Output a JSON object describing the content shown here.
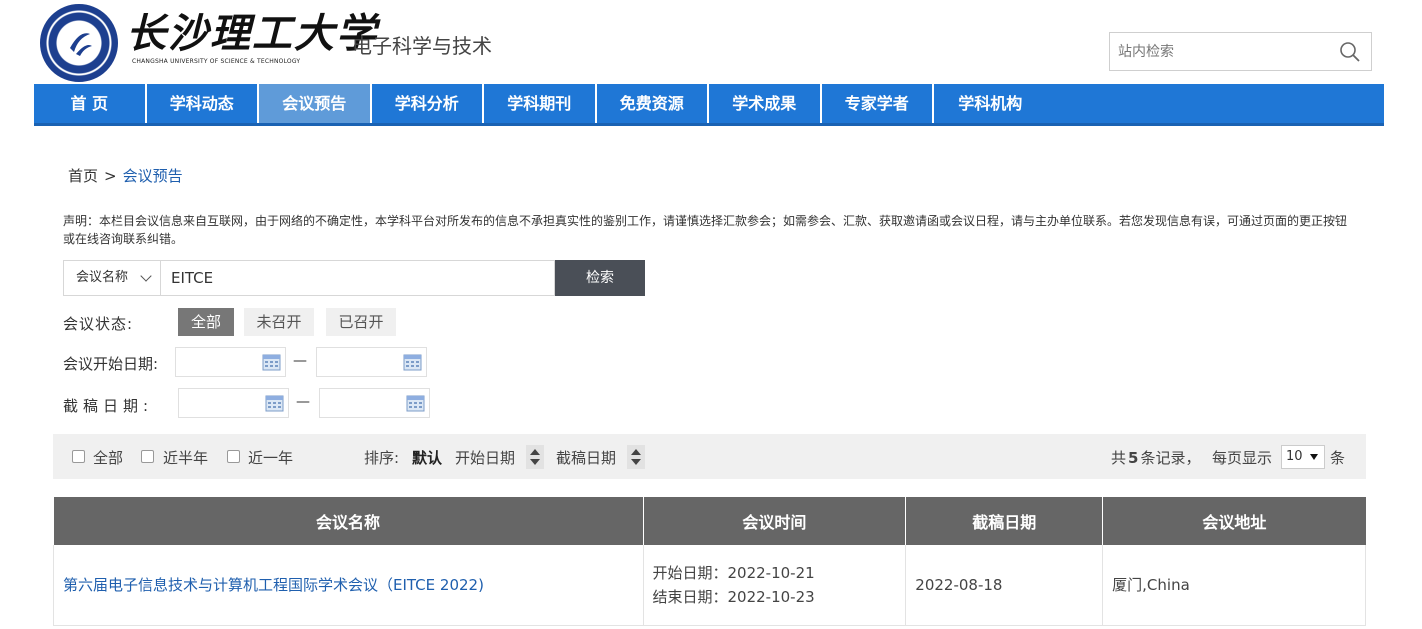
{
  "header": {
    "logo_cn": "长沙理工大学",
    "logo_en": "CHANGSHA UNIVERSITY OF SCIENCE & TECHNOLOGY",
    "site_title": "电子科学与技术",
    "search_placeholder": "站内检索"
  },
  "nav": {
    "items": [
      "首 页",
      "学科动态",
      "会议预告",
      "学科分析",
      "学科期刊",
      "免费资源",
      "学术成果",
      "专家学者",
      "学科机构"
    ],
    "active_index": 2
  },
  "breadcrumb": {
    "home": "首页",
    "separator": ">",
    "current": "会议预告"
  },
  "notice": "声明：本栏目会议信息来自互联网，由于网络的不确定性，本学科平台对所发布的信息不承担真实性的鉴别工作，请谨慎选择汇款参会；如需参会、汇款、获取邀请函或会议日程，请与主办单位联系。若您发现信息有误，可通过页面的更正按钮或在线咨询联系纠错。",
  "query": {
    "field": "会议名称",
    "value": "EITCE",
    "button": "检索"
  },
  "filters": {
    "status_label": "会议状态:",
    "status_options": [
      "全部",
      "未召开",
      "已召开"
    ],
    "status_active": "全部",
    "start_date_label": "会议开始日期:",
    "deadline_label": "截稿日期:",
    "range_dash": "—"
  },
  "toolbar": {
    "time_filters": [
      "全部",
      "近半年",
      "近一年"
    ],
    "sort_label": "排序:",
    "sort_default": "默认",
    "sort_start": "开始日期",
    "sort_deadline": "截稿日期",
    "total_prefix": "共",
    "total_count": "5",
    "total_suffix": "条记录，",
    "per_page_prefix": "每页显示",
    "per_page_value": "10",
    "per_page_suffix": "条"
  },
  "table": {
    "headers": [
      "会议名称",
      "会议时间",
      "截稿日期",
      "会议地址"
    ],
    "rows": [
      {
        "name": "第六届电子信息技术与计算机工程国际学术会议（EITCE 2022)",
        "start": "开始日期：2022-10-21",
        "end": "结束日期：2022-10-23",
        "deadline": "2022-08-18",
        "address": "厦门,China"
      }
    ]
  },
  "colors": {
    "nav_bg": "#1f77d6",
    "nav_active": "#5f9bd9",
    "table_header": "#666666",
    "link": "#1f5fae",
    "button_dark": "#4a4f57"
  }
}
